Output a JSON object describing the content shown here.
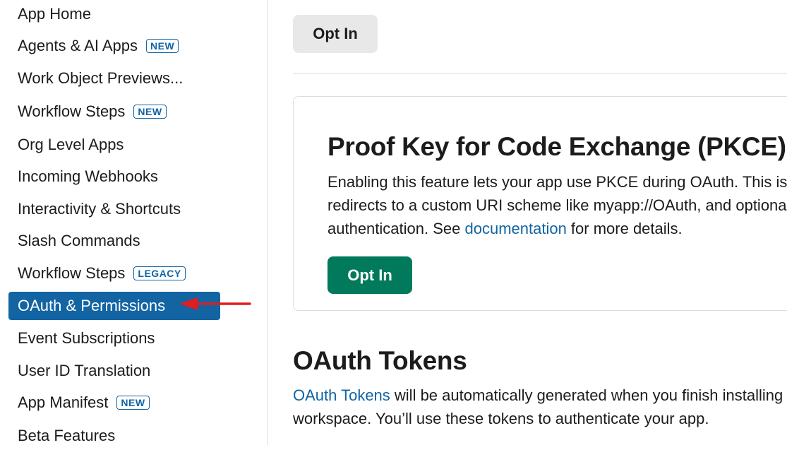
{
  "sidebar": {
    "items": [
      {
        "label": "App Home",
        "badge": ""
      },
      {
        "label": "Agents & AI Apps",
        "badge": "NEW"
      },
      {
        "label": "Work Object Previews...",
        "badge": ""
      },
      {
        "label": "Workflow Steps",
        "badge": "NEW"
      },
      {
        "label": "Org Level Apps",
        "badge": ""
      },
      {
        "label": "Incoming Webhooks",
        "badge": ""
      },
      {
        "label": "Interactivity & Shortcuts",
        "badge": ""
      },
      {
        "label": "Slash Commands",
        "badge": ""
      },
      {
        "label": "Workflow Steps",
        "badge": "LEGACY"
      },
      {
        "label": "OAuth & Permissions",
        "badge": "",
        "active": true
      },
      {
        "label": "Event Subscriptions",
        "badge": ""
      },
      {
        "label": "User ID Translation",
        "badge": ""
      },
      {
        "label": "App Manifest",
        "badge": "NEW"
      },
      {
        "label": "Beta Features",
        "badge": ""
      }
    ]
  },
  "main": {
    "top_button": "Opt In",
    "pkce": {
      "title": "Proof Key for Code Exchange (PKCE)",
      "line1": "Enabling this feature lets your app use PKCE during OAuth. This is",
      "line2": "redirects to a custom URI scheme like myapp://OAuth, and optiona",
      "line3_pre": "authentication. See ",
      "line3_link": "documentation",
      "line3_post": " for more details.",
      "button": "Opt In"
    },
    "tokens": {
      "title": "OAuth Tokens",
      "line1_link": "OAuth Tokens",
      "line1_post": " will be automatically generated when you finish installing",
      "line2": "workspace. You’ll use these tokens to authenticate your app."
    }
  },
  "colors": {
    "accent": "#1264a3",
    "primary_button": "#007a5a",
    "annotation_arrow": "#e01e1e"
  }
}
